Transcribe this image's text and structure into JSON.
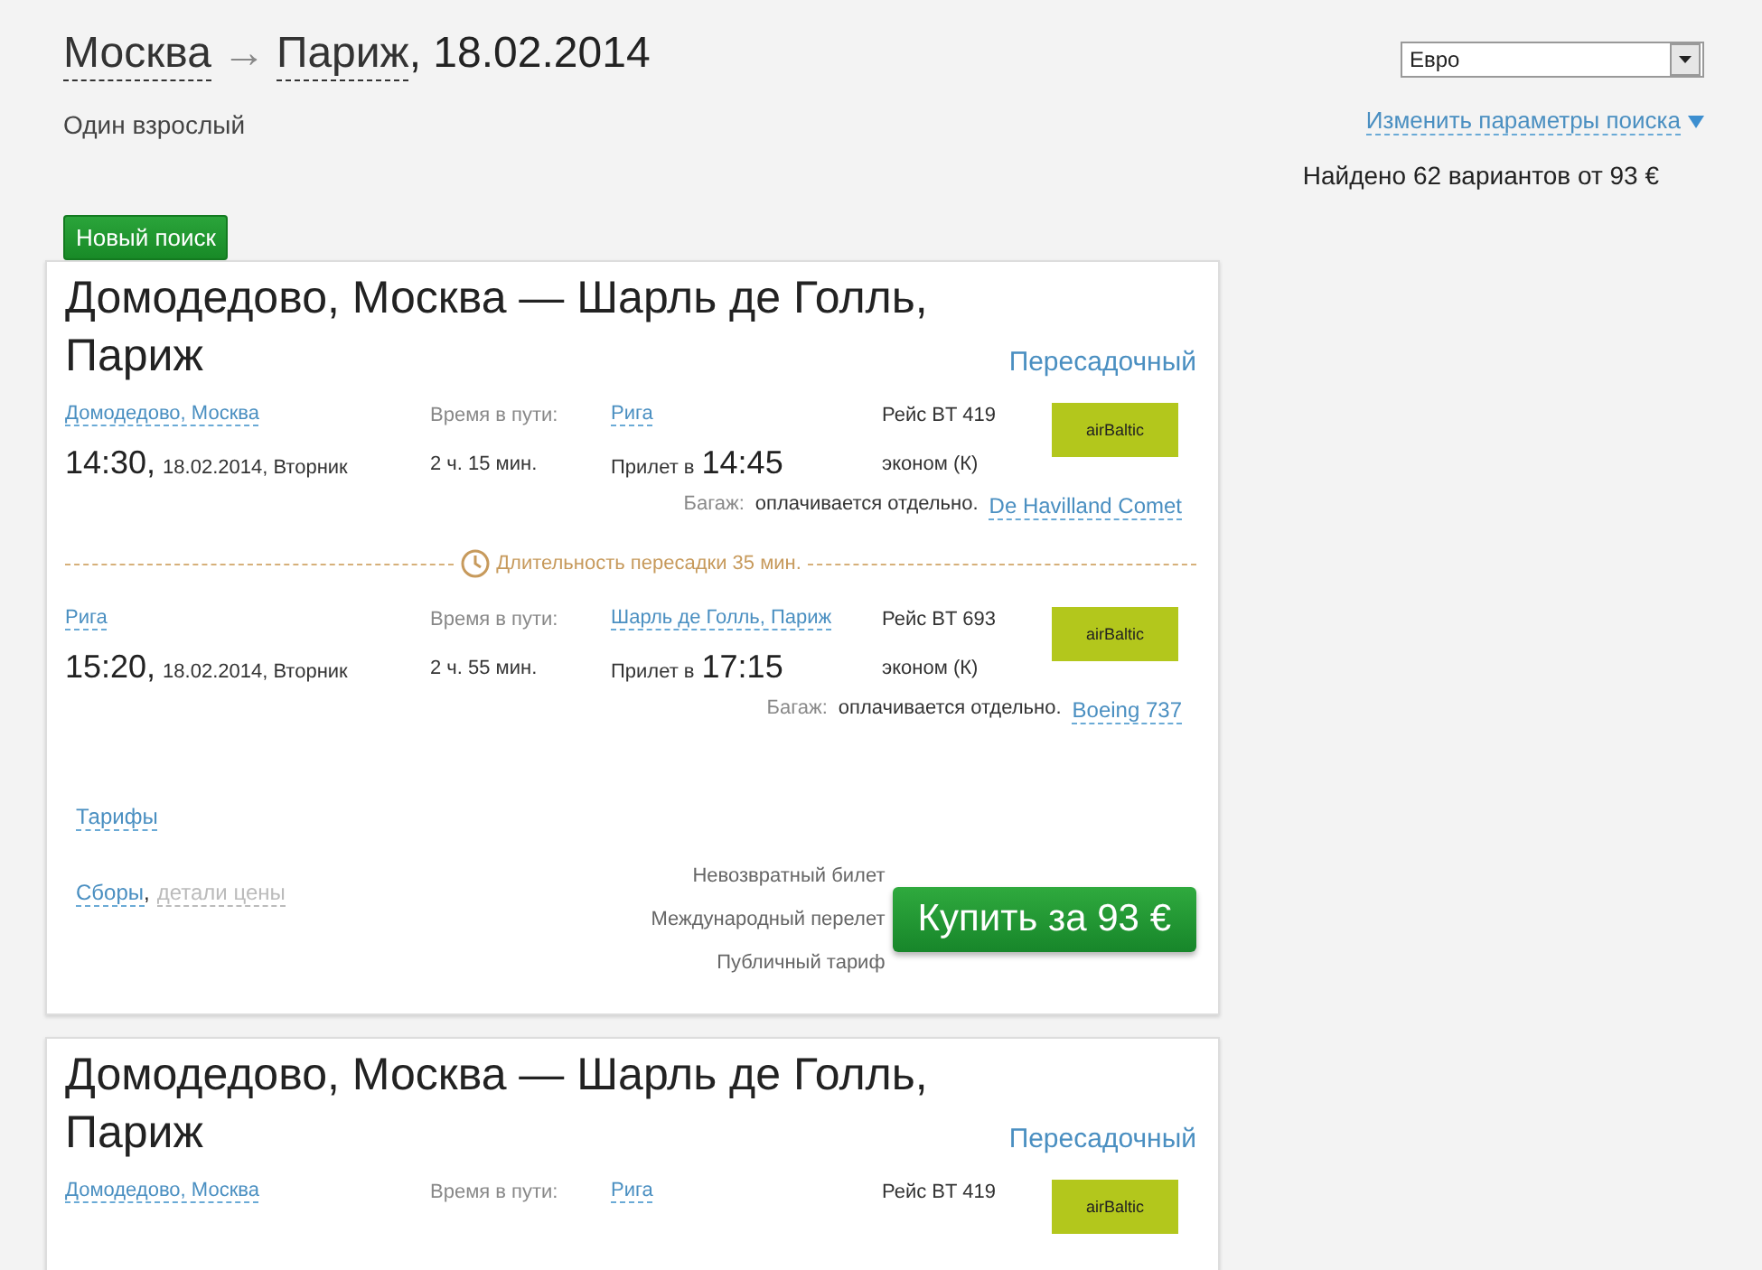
{
  "header": {
    "from": "Москва",
    "arrow": "→",
    "to": "Париж",
    "date": ", 18.02.2014",
    "passengers": "Один взрослый",
    "currency": "Евро",
    "change_search": "Изменить параметры поиска",
    "results": "Найдено 62 вариантов от 93 €",
    "new_search": "Новый поиск"
  },
  "cards": [
    {
      "title": "Домодедово, Москва — Шарль де Голль, Париж",
      "type": "Пересадочный",
      "segments": [
        {
          "from": "Домодедово, Москва",
          "travel_label": "Время в пути:",
          "to": "Рига",
          "flight": "Рейс BT 419",
          "airline": "airBaltic",
          "departure_time": "14:30,",
          "departure_date": "18.02.2014, Вторник",
          "duration": "2 ч. 15 мин.",
          "arrival_label": "Прилет в",
          "arrival_time": "14:45",
          "cabin": "эконом (К)",
          "baggage_label": "Багаж:",
          "baggage": "оплачивается отдельно.",
          "aircraft": "De Havilland Comet"
        },
        {
          "from": "Рига",
          "travel_label": "Время в пути:",
          "to": "Шарль де Голль, Париж",
          "flight": "Рейс BT 693",
          "airline": "airBaltic",
          "departure_time": "15:20,",
          "departure_date": "18.02.2014, Вторник",
          "duration": "2 ч. 55 мин.",
          "arrival_label": "Прилет в",
          "arrival_time": "17:15",
          "cabin": "эконом (К)",
          "baggage_label": "Багаж:",
          "baggage": "оплачивается отдельно.",
          "aircraft": "Boeing 737"
        }
      ],
      "layover": "Длительность пересадки 35 мин.",
      "tariffs": "Тарифы",
      "fees": "Сборы",
      "fees_separator": ",",
      "price_details": "детали цены",
      "conditions": [
        "Невозвратный билет",
        "Международный перелет",
        "Публичный тариф"
      ],
      "buy": "Купить за 93 €"
    },
    {
      "title": "Домодедово, Москва — Шарль де Голль, Париж",
      "type": "Пересадочный",
      "segments": [
        {
          "from": "Домодедово, Москва",
          "travel_label": "Время в пути:",
          "to": "Рига",
          "flight": "Рейс BT 419",
          "airline": "airBaltic"
        }
      ]
    }
  ]
}
